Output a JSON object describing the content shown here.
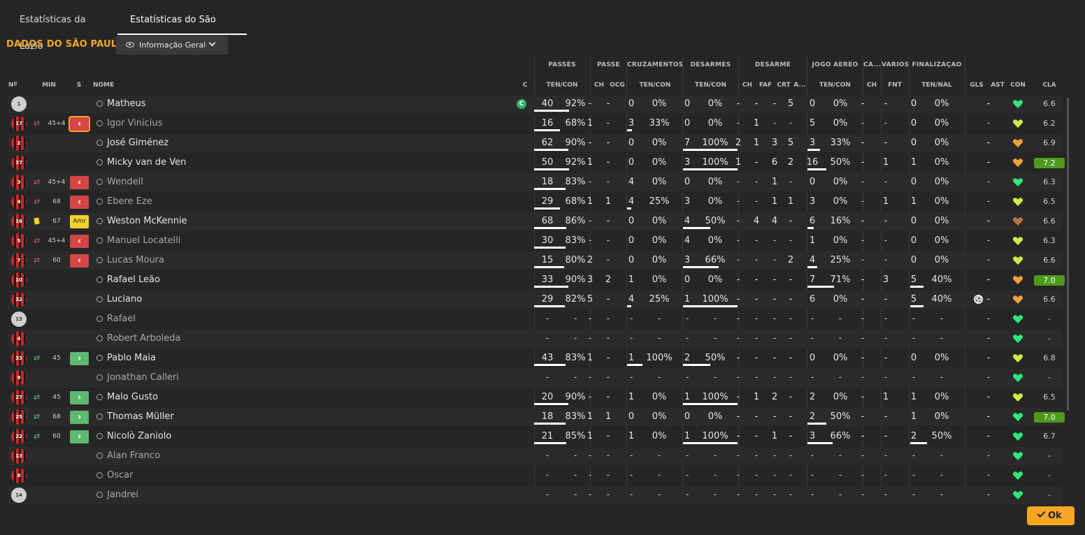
{
  "tabs": [
    "Estatísticas da Lazio",
    "Estatísticas do São Paulo"
  ],
  "heading": "DADOS DO SÃO PAULO",
  "view_dropdown": "Informação Geral",
  "ok_label": "Ok",
  "groups": [
    "PASSES",
    "PASSE",
    "CRUZAMENTOS",
    "DESARMES",
    "DESARME",
    "JOGO AÉREO",
    "CA...",
    "VÁRIOS",
    "FINALIZAÇÃO"
  ],
  "columns": [
    "Nº",
    "MIN",
    "S",
    "NOME",
    "C",
    "TEN/CON",
    "CH",
    "OCG",
    "TEN/CON",
    "TEN/CON",
    "CH",
    "FAF",
    "CRT",
    "A...",
    "TEN/CON",
    "CH",
    "FNT",
    "TEN/NAL",
    "GLS",
    "AST",
    "CON",
    "CLA"
  ],
  "colors": {
    "accent": "#f5a623",
    "heart_green": "#2ee87a",
    "heart_yellow": "#d6e84a",
    "heart_orange": "#f0a23c",
    "heart_brown": "#b5794a",
    "rating_high": "#4e9a1c"
  },
  "players": [
    {
      "no": "1",
      "kit": "gk",
      "name": "Matheus",
      "captain": "C",
      "bench": false,
      "sub": "",
      "min": "",
      "btn": "",
      "v": [
        "40",
        "92%",
        "-",
        "-",
        "0",
        "0%",
        "0",
        "0%",
        "-",
        "-",
        "-",
        "5",
        "0",
        "0%",
        "-",
        "-",
        "0",
        "0%",
        "",
        "-"
      ],
      "bars": [
        0.92,
        0,
        0,
        0,
        0
      ],
      "cla": "6.6",
      "hi": false,
      "heart": "heart_green"
    },
    {
      "no": "17",
      "kit": "k",
      "name": "Igor Vinicius",
      "bench": true,
      "sub": "out",
      "min": "45+4",
      "btn": "‹",
      "btnc": "red bordered",
      "v": [
        "16",
        "68%",
        "1",
        "-",
        "3",
        "33%",
        "0",
        "0%",
        "-",
        "1",
        "-",
        "-",
        "5",
        "0%",
        "-",
        "-",
        "0",
        "0%",
        "",
        "-"
      ],
      "bars": [
        0.68,
        0.33,
        0,
        0,
        0
      ],
      "cla": "6.2",
      "hi": false,
      "heart": "heart_yellow"
    },
    {
      "no": "2",
      "kit": "k",
      "name": "José Giménez",
      "bench": false,
      "sub": "",
      "min": "",
      "btn": "",
      "v": [
        "62",
        "90%",
        "-",
        "-",
        "0",
        "0%",
        "7",
        "100%",
        "2",
        "1",
        "3",
        "5",
        "3",
        "33%",
        "-",
        "-",
        "0",
        "0%",
        "",
        "-"
      ],
      "bars": [
        0.9,
        0,
        1,
        0.33,
        0
      ],
      "cla": "6.9",
      "hi": false,
      "heart": "heart_orange"
    },
    {
      "no": "37",
      "kit": "k",
      "name": "Micky van de Ven",
      "bench": false,
      "sub": "",
      "min": "",
      "btn": "",
      "v": [
        "50",
        "92%",
        "1",
        "-",
        "0",
        "0%",
        "3",
        "100%",
        "1",
        "-",
        "6",
        "2",
        "16",
        "50%",
        "-",
        "1",
        "1",
        "0%",
        "",
        "-"
      ],
      "bars": [
        0.92,
        0,
        1,
        0.5,
        0
      ],
      "cla": "7.2",
      "hi": true,
      "heart": "heart_orange"
    },
    {
      "no": "3",
      "kit": "k",
      "name": "Wendell",
      "bench": true,
      "sub": "out",
      "min": "45+4",
      "btn": "‹",
      "btnc": "red",
      "v": [
        "18",
        "83%",
        "-",
        "-",
        "4",
        "0%",
        "0",
        "0%",
        "-",
        "-",
        "1",
        "-",
        "0",
        "0%",
        "-",
        "-",
        "0",
        "0%",
        "",
        "-"
      ],
      "bars": [
        0.83,
        0,
        0,
        0,
        0
      ],
      "cla": "6.3",
      "hi": false,
      "heart": "heart_green"
    },
    {
      "no": "4",
      "kit": "k",
      "name": "Ebere Eze",
      "bench": true,
      "sub": "out",
      "min": "68",
      "btn": "‹",
      "btnc": "red",
      "v": [
        "29",
        "68%",
        "1",
        "1",
        "4",
        "25%",
        "3",
        "0%",
        "-",
        "-",
        "1",
        "1",
        "3",
        "0%",
        "-",
        "1",
        "1",
        "0%",
        "",
        "-"
      ],
      "bars": [
        0.68,
        0.25,
        0,
        0,
        0
      ],
      "cla": "6.5",
      "hi": false,
      "heart": "heart_yellow"
    },
    {
      "no": "16",
      "kit": "k",
      "name": "Weston McKennie",
      "bench": false,
      "sub": "card",
      "min": "67",
      "btn": "Amr",
      "btnc": "yel",
      "v": [
        "68",
        "86%",
        "-",
        "-",
        "0",
        "0%",
        "4",
        "50%",
        "-",
        "4",
        "4",
        "-",
        "6",
        "16%",
        "-",
        "-",
        "0",
        "0%",
        "",
        "-"
      ],
      "bars": [
        0.86,
        0,
        0.5,
        0.16,
        0
      ],
      "cla": "6.6",
      "hi": false,
      "heart": "heart_brown"
    },
    {
      "no": "5",
      "kit": "k",
      "name": "Manuel Locatelli",
      "bench": true,
      "sub": "out",
      "min": "45+4",
      "btn": "‹",
      "btnc": "red",
      "v": [
        "30",
        "83%",
        "-",
        "-",
        "0",
        "0%",
        "4",
        "0%",
        "-",
        "-",
        "-",
        "-",
        "1",
        "0%",
        "-",
        "-",
        "0",
        "0%",
        "",
        "-"
      ],
      "bars": [
        0.83,
        0,
        0,
        0,
        0
      ],
      "cla": "6.3",
      "hi": false,
      "heart": "heart_yellow"
    },
    {
      "no": "7",
      "kit": "k",
      "name": "Lucas Moura",
      "bench": true,
      "sub": "out",
      "min": "60",
      "btn": "‹",
      "btnc": "red",
      "v": [
        "15",
        "80%",
        "2",
        "-",
        "0",
        "0%",
        "3",
        "66%",
        "-",
        "-",
        "-",
        "2",
        "4",
        "25%",
        "-",
        "-",
        "0",
        "0%",
        "",
        "-"
      ],
      "bars": [
        0.8,
        0,
        0.66,
        0.25,
        0
      ],
      "cla": "6.6",
      "hi": false,
      "heart": "heart_yellow"
    },
    {
      "no": "10",
      "kit": "k",
      "name": "Rafael Leão",
      "bench": false,
      "sub": "",
      "min": "",
      "btn": "",
      "v": [
        "33",
        "90%",
        "3",
        "2",
        "1",
        "0%",
        "0",
        "0%",
        "-",
        "-",
        "-",
        "-",
        "7",
        "71%",
        "-",
        "3",
        "5",
        "40%",
        "",
        "-"
      ],
      "bars": [
        0.9,
        0,
        0,
        0.71,
        0.4
      ],
      "cla": "7.0",
      "hi": true,
      "heart": "heart_orange"
    },
    {
      "no": "32",
      "kit": "k",
      "name": "Luciano",
      "bench": false,
      "sub": "",
      "min": "",
      "btn": "",
      "v": [
        "29",
        "82%",
        "5",
        "-",
        "4",
        "25%",
        "1",
        "100%",
        "-",
        "-",
        "-",
        "-",
        "6",
        "0%",
        "-",
        "-",
        "5",
        "40%",
        "ball",
        "-"
      ],
      "bars": [
        0.82,
        0.25,
        1,
        0,
        0.4
      ],
      "cla": "6.6",
      "hi": false,
      "heart": "heart_orange"
    },
    {
      "no": "13",
      "kit": "gk",
      "name": "Rafael",
      "bench": true,
      "sub": "",
      "min": "",
      "btn": "",
      "v": [
        "-",
        "-",
        "-",
        "-",
        "-",
        "-",
        "-",
        "-",
        "-",
        "-",
        "-",
        "-",
        "-",
        "-",
        "-",
        "-",
        "-",
        "-",
        "",
        "-"
      ],
      "bars": [
        0,
        0,
        0,
        0,
        0
      ],
      "cla": "-",
      "hi": false,
      "heart": "heart_green"
    },
    {
      "no": "4",
      "kit": "k",
      "name": "Robert Arboleda",
      "bench": true,
      "sub": "",
      "min": "",
      "btn": "",
      "v": [
        "-",
        "-",
        "-",
        "-",
        "-",
        "-",
        "-",
        "-",
        "-",
        "-",
        "-",
        "-",
        "-",
        "-",
        "-",
        "-",
        "-",
        "-",
        "",
        "-"
      ],
      "bars": [
        0,
        0,
        0,
        0,
        0
      ],
      "cla": "-",
      "hi": false,
      "heart": "heart_green"
    },
    {
      "no": "33",
      "kit": "k",
      "name": "Pablo Maia",
      "bench": false,
      "sub": "in",
      "min": "45",
      "btn": "›",
      "btnc": "green",
      "v": [
        "43",
        "83%",
        "1",
        "-",
        "1",
        "100%",
        "2",
        "50%",
        "-",
        "-",
        "-",
        "-",
        "0",
        "0%",
        "-",
        "-",
        "0",
        "0%",
        "",
        "-"
      ],
      "bars": [
        0.83,
        1,
        0.5,
        0,
        0
      ],
      "cla": "6.8",
      "hi": false,
      "heart": "heart_yellow"
    },
    {
      "no": "9",
      "kit": "k",
      "name": "Jonathan Calleri",
      "bench": true,
      "sub": "",
      "min": "",
      "btn": "",
      "v": [
        "-",
        "-",
        "-",
        "-",
        "-",
        "-",
        "-",
        "-",
        "-",
        "-",
        "-",
        "-",
        "-",
        "-",
        "-",
        "-",
        "-",
        "-",
        "",
        "-"
      ],
      "bars": [
        0,
        0,
        0,
        0,
        0
      ],
      "cla": "-",
      "hi": false,
      "heart": "heart_green"
    },
    {
      "no": "27",
      "kit": "k",
      "name": "Malo Gusto",
      "bench": false,
      "sub": "in",
      "min": "45",
      "btn": "›",
      "btnc": "green",
      "v": [
        "20",
        "90%",
        "-",
        "-",
        "1",
        "0%",
        "1",
        "100%",
        "-",
        "1",
        "2",
        "-",
        "2",
        "0%",
        "-",
        "1",
        "1",
        "0%",
        "",
        "-"
      ],
      "bars": [
        0.9,
        0,
        1,
        0,
        0
      ],
      "cla": "6.5",
      "hi": false,
      "heart": "heart_yellow"
    },
    {
      "no": "25",
      "kit": "k",
      "name": "Thomas Müller",
      "bench": false,
      "sub": "in",
      "min": "68",
      "btn": "›",
      "btnc": "green",
      "v": [
        "18",
        "83%",
        "1",
        "1",
        "0",
        "0%",
        "0",
        "0%",
        "-",
        "-",
        "-",
        "-",
        "2",
        "50%",
        "-",
        "-",
        "1",
        "0%",
        "",
        "-"
      ],
      "bars": [
        0.83,
        0,
        0,
        0.5,
        0
      ],
      "cla": "7.0",
      "hi": true,
      "heart": "heart_green"
    },
    {
      "no": "22",
      "kit": "k",
      "name": "Nicolò Zaniolo",
      "bench": false,
      "sub": "in",
      "min": "60",
      "btn": "›",
      "btnc": "green",
      "v": [
        "21",
        "85%",
        "1",
        "-",
        "1",
        "0%",
        "1",
        "100%",
        "-",
        "-",
        "1",
        "-",
        "3",
        "66%",
        "-",
        "-",
        "2",
        "50%",
        "",
        "-"
      ],
      "bars": [
        0.85,
        0,
        1,
        0.66,
        0.5
      ],
      "cla": "6.7",
      "hi": false,
      "heart": "heart_green"
    },
    {
      "no": "13",
      "kit": "k",
      "name": "Alan Franco",
      "bench": true,
      "sub": "",
      "min": "",
      "btn": "",
      "v": [
        "-",
        "-",
        "-",
        "-",
        "-",
        "-",
        "-",
        "-",
        "-",
        "-",
        "-",
        "-",
        "-",
        "-",
        "-",
        "-",
        "-",
        "-",
        "",
        "-"
      ],
      "bars": [
        0,
        0,
        0,
        0,
        0
      ],
      "cla": "-",
      "hi": false,
      "heart": "heart_green"
    },
    {
      "no": "8",
      "kit": "k",
      "name": "Oscar",
      "bench": true,
      "sub": "",
      "min": "",
      "btn": "",
      "v": [
        "-",
        "-",
        "-",
        "-",
        "-",
        "-",
        "-",
        "-",
        "-",
        "-",
        "-",
        "-",
        "-",
        "-",
        "-",
        "-",
        "-",
        "-",
        "",
        "-"
      ],
      "bars": [
        0,
        0,
        0,
        0,
        0
      ],
      "cla": "-",
      "hi": false,
      "heart": "heart_green"
    },
    {
      "no": "14",
      "kit": "gk",
      "name": "Jandrei",
      "bench": true,
      "sub": "",
      "min": "",
      "btn": "",
      "v": [
        "-",
        "-",
        "-",
        "-",
        "-",
        "-",
        "-",
        "-",
        "-",
        "-",
        "-",
        "-",
        "-",
        "-",
        "-",
        "-",
        "-",
        "-",
        "",
        "-"
      ],
      "bars": [
        0,
        0,
        0,
        0,
        0
      ],
      "cla": "-",
      "hi": false,
      "heart": "heart_green"
    }
  ]
}
